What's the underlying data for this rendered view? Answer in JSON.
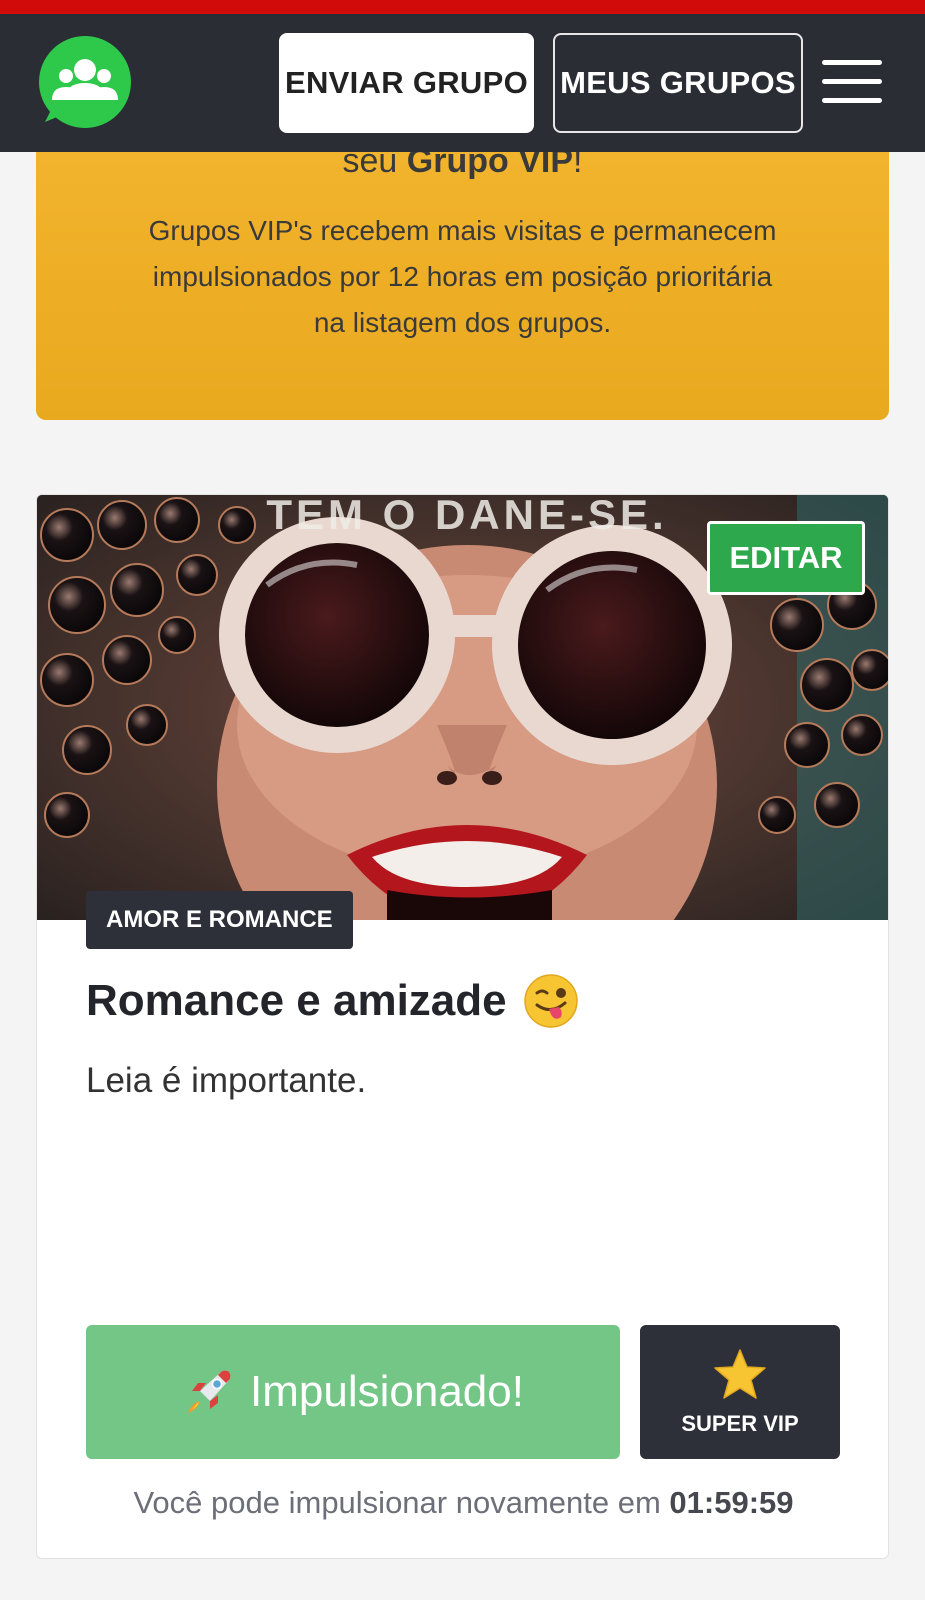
{
  "header": {
    "logo_icon": "whatsapp-group-icon",
    "send_group_label": "ENVIAR GRUPO",
    "my_groups_label": "MEUS GRUPOS",
    "menu_icon": "hamburger-menu-icon"
  },
  "vip_banner": {
    "title_prefix": "seu ",
    "title_bold": "Grupo VIP",
    "title_suffix": "!",
    "text": "Grupos VIP's recebem mais visitas e permanecem impulsionados por 12 horas em posição prioritária na listagem dos grupos."
  },
  "group_card": {
    "image_overlay_text": "TEM O DANE-SE.",
    "edit_label": "EDITAR",
    "category": "AMOR E ROMANCE",
    "title": "Romance e amizade",
    "title_emoji": "winking-tongue-emoji",
    "description": "Leia é importante.",
    "boost_label": "Impulsionado!",
    "boost_icon": "rocket-icon",
    "super_vip_label": "SUPER VIP",
    "super_vip_icon": "star-icon",
    "countdown_prefix": "Você pode impulsionar novamente em",
    "countdown_value": "01:59:59"
  },
  "colors": {
    "accent_red": "#d10a0a",
    "navbar": "#2a2d34",
    "vip_banner": "#efb227",
    "edit_green": "#2ea84c",
    "boost_green": "#74c686",
    "dark_badge": "#2d3038"
  }
}
